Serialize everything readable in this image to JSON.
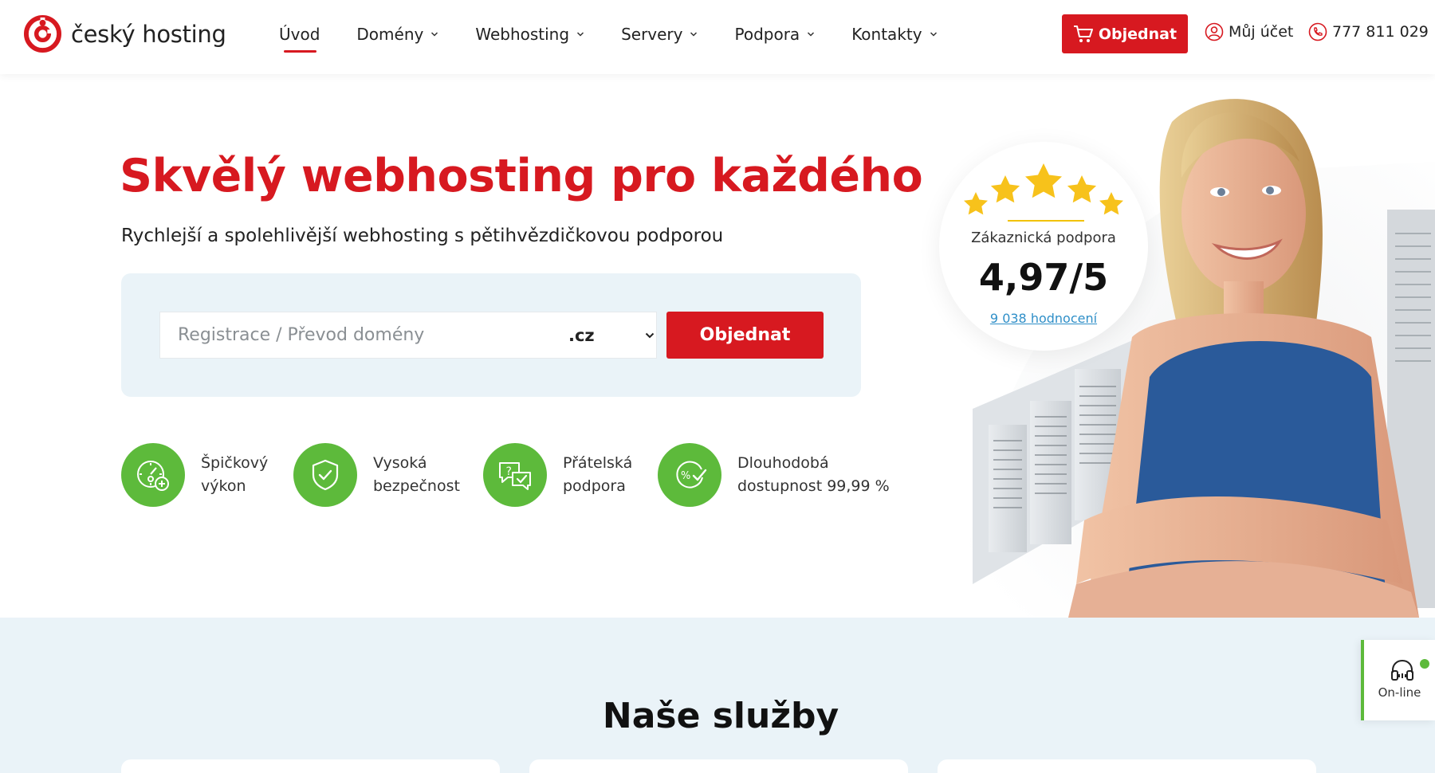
{
  "brand": {
    "name": "český hosting",
    "accent": "#d71920",
    "green": "#5dba3b"
  },
  "header": {
    "nav": [
      {
        "label": "Úvod",
        "active": true
      },
      {
        "label": "Domény",
        "dropdown": true
      },
      {
        "label": "Webhosting",
        "dropdown": true
      },
      {
        "label": "Servery",
        "dropdown": true
      },
      {
        "label": "Podpora",
        "dropdown": true
      },
      {
        "label": "Kontakty",
        "dropdown": true
      }
    ],
    "order_button": "Objednat",
    "account": "Můj účet",
    "phone": "777 811 029"
  },
  "hero": {
    "title": "Skvělý webhosting pro každého",
    "subtitle": "Rychlejší a spolehlivější webhosting s pětihvězdičkovou podporou",
    "search": {
      "placeholder": "Registrace / Převod domény",
      "tld": ".cz",
      "button": "Objednat"
    },
    "features": [
      {
        "icon": "speedometer-icon",
        "line1": "Špičkový",
        "line2": "výkon"
      },
      {
        "icon": "shield-check-icon",
        "line1": "Vysoká",
        "line2": "bezpečnost"
      },
      {
        "icon": "chat-bubbles-icon",
        "line1": "Přátelská",
        "line2": "podpora"
      },
      {
        "icon": "availability-percent-icon",
        "line1": "Dlouhodobá",
        "line2": "dostupnost 99,99 %"
      }
    ]
  },
  "rating": {
    "stars": 5,
    "label": "Zákaznická podpora",
    "score": "4,97/5",
    "reviews_link": "9 038 hodnocení"
  },
  "services": {
    "title": "Naše služby"
  },
  "chat": {
    "label": "On-line",
    "status_color": "#5dba3b"
  }
}
